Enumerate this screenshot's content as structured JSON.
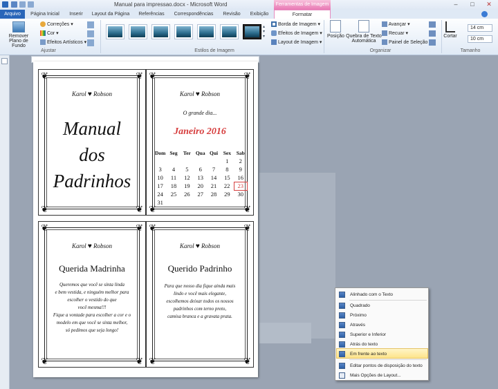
{
  "window": {
    "title": "Manual para impressao.docx - Microsoft Word",
    "context_header": "Ferramentas de Imagem"
  },
  "tabs": [
    "Arquivo",
    "Página Inicial",
    "Inserir",
    "Layout da Página",
    "Referências",
    "Correspondências",
    "Revisão",
    "Exibição",
    "Formatar"
  ],
  "ribbon": {
    "remove_bg": "Remover Plano de Fundo",
    "corrections": "Correções",
    "color": "Cor",
    "artistic": "Efeitos Artísticos",
    "adjust_label": "Ajustar",
    "styles_label": "Estilos de Imagem",
    "border": "Borda de Imagem",
    "effects": "Efeitos de Imagem",
    "layout": "Layout de Imagem",
    "position": "Posição",
    "wrap": "Quebra de Texto Automática",
    "forward": "Avançar",
    "backward": "Recuar",
    "selection": "Painel de Seleção",
    "arrange_label": "Organizar",
    "crop": "Cortar",
    "height": "14 cm",
    "width": "10 cm",
    "size_label": "Tamanho"
  },
  "doc": {
    "monogram_left": "Karol",
    "monogram_right": "Robson",
    "card1_lines": [
      "Manual",
      "dos",
      "Padrinhos"
    ],
    "card2_top": "O grande dia...",
    "card2_month": "Janeiro 2016",
    "weekdays": [
      "Dom",
      "Seg",
      "Ter",
      "Qua",
      "Qui",
      "Sex",
      "Sab"
    ],
    "calendar_rows": [
      [
        "",
        "",
        "",
        "",
        "",
        "",
        "1",
        "2"
      ],
      [
        "3",
        "4",
        "5",
        "6",
        "7",
        "8",
        "9"
      ],
      [
        "10",
        "11",
        "12",
        "13",
        "14",
        "15",
        "16"
      ],
      [
        "17",
        "18",
        "19",
        "20",
        "21",
        "22",
        "23"
      ],
      [
        "24",
        "25",
        "26",
        "27",
        "28",
        "29",
        "30"
      ],
      [
        "31",
        "",
        "",
        "",
        "",
        "",
        ""
      ]
    ],
    "card3_title": "Querida Madrinha",
    "card3_body": [
      "Queremos que você se sinta linda",
      "e bem vestida, e ninguém melhor para",
      "escolher o vestido do que",
      "você mesma!!!",
      "Fique a vontade para escolher a cor e o",
      "modelo em que você se sinta melhor,",
      "só pedimos que seja longo!"
    ],
    "card4_title": "Querido Padrinho",
    "card4_body": [
      "Para que nosso dia fique ainda mais",
      "lindo e você mais elegante,",
      "escolhemos deixar todos os nossos",
      "padrinhos com terno preto,",
      "camisa branca e a gravata prata."
    ]
  },
  "context_menu": {
    "items": [
      "Alinhado com o Texto",
      "Quadrado",
      "Próximo",
      "Através",
      "Superior e Inferior",
      "Atrás do texto",
      "Em frente ao texto",
      "Editar pontos de disposição do texto",
      "Mais Opções de Layout..."
    ],
    "highlighted_index": 6
  },
  "colors": {
    "accent": "#2a66b9",
    "context_tab": "#e879b4",
    "calendar_month": "#d63d3d",
    "highlight": "#fde48a"
  }
}
